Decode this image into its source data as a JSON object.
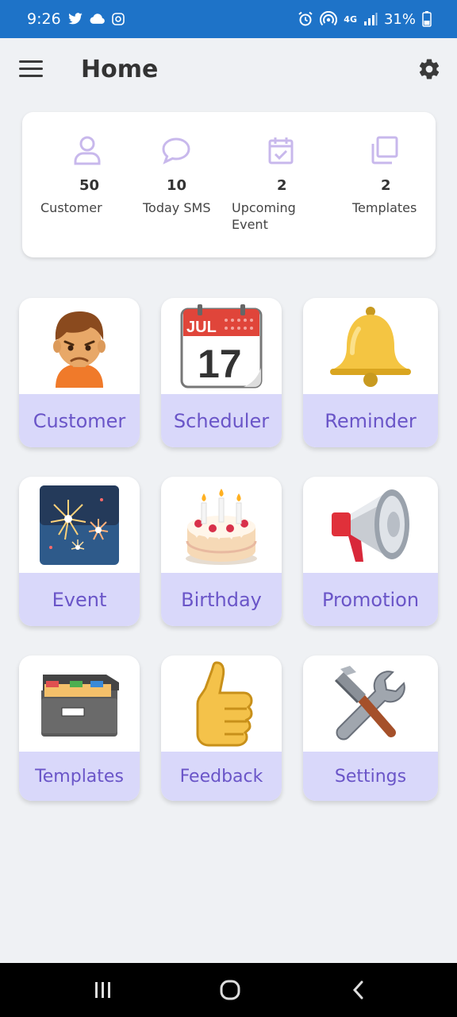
{
  "status_bar": {
    "time": "9:26",
    "battery": "31%",
    "network": "4G",
    "icons": [
      "twitter-icon",
      "cloud-icon",
      "app-icon",
      "alarm-icon",
      "hotspot-icon",
      "signal-icon",
      "battery-icon"
    ]
  },
  "app_bar": {
    "title": "Home",
    "menu_icon": "hamburger-menu-icon",
    "settings_icon": "gear-icon"
  },
  "stats": [
    {
      "value": "50",
      "label": "Customer",
      "icon": "person-icon"
    },
    {
      "value": "10",
      "label": "Today SMS",
      "icon": "chat-bubble-icon"
    },
    {
      "value": "2",
      "label_line1": "Upcoming",
      "label_line2": "Event",
      "icon": "calendar-check-icon"
    },
    {
      "value": "2",
      "label": "Templates",
      "icon": "copy-icon"
    }
  ],
  "tiles": [
    {
      "label": "Customer",
      "icon": "person-emoji-icon"
    },
    {
      "label": "Scheduler",
      "icon": "calendar-emoji-icon",
      "calendar_month": "JUL",
      "calendar_day": "17"
    },
    {
      "label": "Reminder",
      "icon": "bell-emoji-icon"
    },
    {
      "label": "Event",
      "icon": "fireworks-emoji-icon"
    },
    {
      "label": "Birthday",
      "icon": "cake-emoji-icon"
    },
    {
      "label": "Promotion",
      "icon": "megaphone-emoji-icon"
    },
    {
      "label": "Templates",
      "icon": "file-box-emoji-icon"
    },
    {
      "label": "Feedback",
      "icon": "thumbs-up-emoji-icon"
    },
    {
      "label": "Settings",
      "icon": "tools-emoji-icon"
    }
  ],
  "nav_bar": {
    "icons": [
      "recent-apps-icon",
      "home-icon",
      "back-icon"
    ]
  },
  "colors": {
    "status_bar": "#1e73c8",
    "background": "#eff1f4",
    "tile_caption_bg": "#d9d8fa",
    "tile_caption_text": "#6a55c8",
    "stat_icon": "#c8b8ec"
  }
}
